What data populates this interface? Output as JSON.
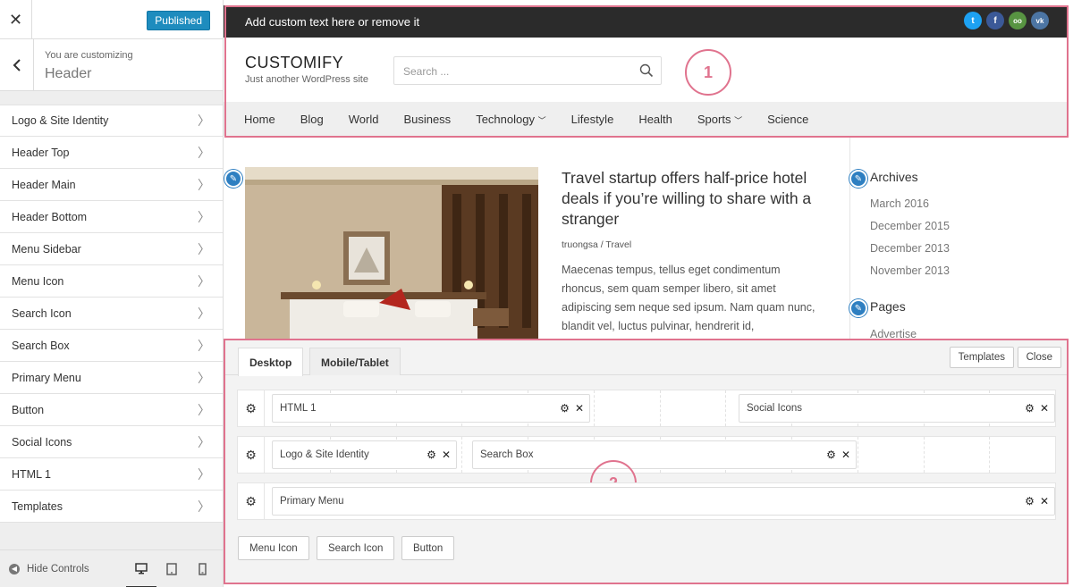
{
  "sidebar": {
    "close_label": "✕",
    "publish_label": "Published",
    "context_small": "You are customizing",
    "context_big": "Header",
    "items": [
      {
        "label": "Logo & Site Identity"
      },
      {
        "label": "Header Top"
      },
      {
        "label": "Header Main"
      },
      {
        "label": "Header Bottom"
      },
      {
        "label": "Menu Sidebar"
      },
      {
        "label": "Menu Icon"
      },
      {
        "label": "Search Icon"
      },
      {
        "label": "Search Box"
      },
      {
        "label": "Primary Menu"
      },
      {
        "label": "Button"
      },
      {
        "label": "Social Icons"
      },
      {
        "label": "HTML 1"
      },
      {
        "label": "Templates"
      }
    ],
    "hide_controls": "Hide Controls",
    "devices": [
      "desktop-icon",
      "tablet-icon",
      "mobile-icon"
    ]
  },
  "preview": {
    "topbar_text": "Add custom text here or remove it",
    "socials": [
      {
        "icon": "twitter-icon",
        "glyph": "t",
        "color": "#1da1f2"
      },
      {
        "icon": "facebook-icon",
        "glyph": "f",
        "color": "#3b5998"
      },
      {
        "icon": "tripadvisor-icon",
        "glyph": "oo",
        "color": "#589442"
      },
      {
        "icon": "vk-icon",
        "glyph": "vk",
        "color": "#4c75a3"
      }
    ],
    "site_title": "CUSTOMIFY",
    "site_tagline": "Just another WordPress site",
    "search_placeholder": "Search ...",
    "marker_1": "1",
    "marker_2": "2",
    "nav": [
      {
        "label": "Home"
      },
      {
        "label": "Blog"
      },
      {
        "label": "World"
      },
      {
        "label": "Business"
      },
      {
        "label": "Technology",
        "dropdown": true
      },
      {
        "label": "Lifestyle"
      },
      {
        "label": "Health"
      },
      {
        "label": "Sports",
        "dropdown": true
      },
      {
        "label": "Science"
      }
    ],
    "post": {
      "title": "Travel startup offers half-price hotel deals if you’re willing to share with a stranger",
      "meta": "truongsa / Travel",
      "excerpt": "Maecenas tempus, tellus eget condimentum rhoncus, sem quam semper libero, sit amet adipiscing sem neque sed ipsum. Nam quam nunc, blandit vel, luctus pulvinar, hendrerit id,"
    },
    "archives_title": "Archives",
    "archives": [
      "March 2016",
      "December 2015",
      "December 2013",
      "November 2013"
    ],
    "pages_title": "Pages",
    "pages": [
      "Advertise"
    ]
  },
  "builder": {
    "tabs": [
      "Desktop",
      "Mobile/Tablet"
    ],
    "templates_label": "Templates",
    "close_label": "Close",
    "rows": [
      {
        "items": [
          "HTML 1",
          "Social Icons"
        ]
      },
      {
        "items": [
          "Logo & Site Identity",
          "Search Box"
        ]
      },
      {
        "items": [
          "Primary Menu"
        ]
      }
    ],
    "available": [
      "Menu Icon",
      "Search Icon",
      "Button"
    ]
  }
}
